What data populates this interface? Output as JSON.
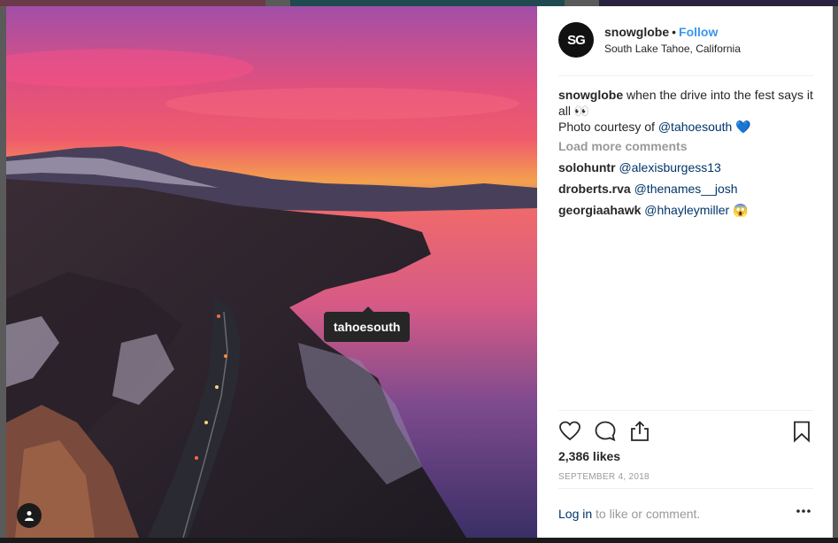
{
  "post": {
    "username": "snowglobe",
    "follow_label": "Follow",
    "location": "South Lake Tahoe, California",
    "avatar_text": "SG",
    "caption": {
      "username": "snowglobe",
      "text_line1": " when the drive into the fest says it all 👀",
      "text_line2_prefix": "Photo courtesy of ",
      "mention": "@tahoesouth",
      "emoji": " 💙"
    },
    "load_more": "Load more comments",
    "comments": [
      {
        "user": "solohuntr",
        "text": "@alexisburgess13",
        "emoji": ""
      },
      {
        "user": "droberts.rva",
        "text": "@thenames__josh",
        "emoji": ""
      },
      {
        "user": "georgiaahawk",
        "text": "@hhayleymiller",
        "emoji": " 😱"
      }
    ],
    "likes": "2,386 likes",
    "date": "SEPTEMBER 4, 2018",
    "login_link": "Log in",
    "login_text": " to like or comment.",
    "tag_tooltip": "tahoesouth"
  },
  "icons": [
    "heart-icon",
    "comment-icon",
    "share-icon",
    "bookmark-icon",
    "more-options-icon",
    "user-tag-icon"
  ],
  "colors": {
    "accent": "#3897f0",
    "mention": "#003569",
    "muted": "#999999",
    "text": "#262626"
  }
}
